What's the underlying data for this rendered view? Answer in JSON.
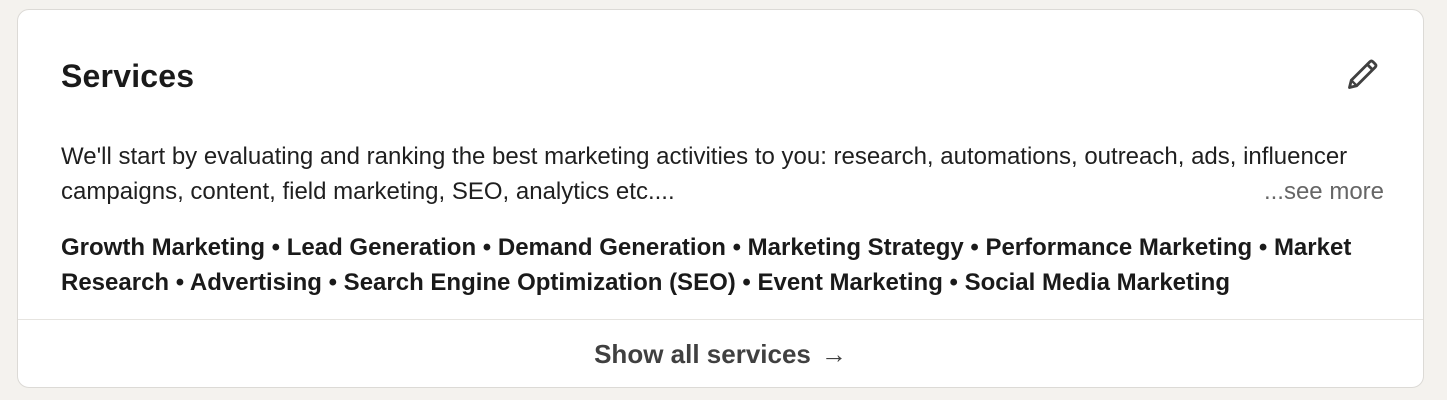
{
  "card": {
    "title": "Services",
    "edit_icon": "pencil-icon",
    "description_lines": [
      "We'll start by evaluating and ranking the best marketing activities to you: research, automations, outreach, ads, influencer",
      "campaigns, content, field marketing, SEO, analytics etc...."
    ],
    "see_more_label": "...see more",
    "services_lines": [
      "Growth Marketing • Lead Generation • Demand Generation • Marketing Strategy • Performance Marketing • Market",
      "Research • Advertising • Search Engine Optimization (SEO) • Event Marketing • Social Media Marketing"
    ],
    "show_all_label": "Show all services",
    "show_all_icon": "arrow-right-icon",
    "arrow_glyph": "→"
  }
}
